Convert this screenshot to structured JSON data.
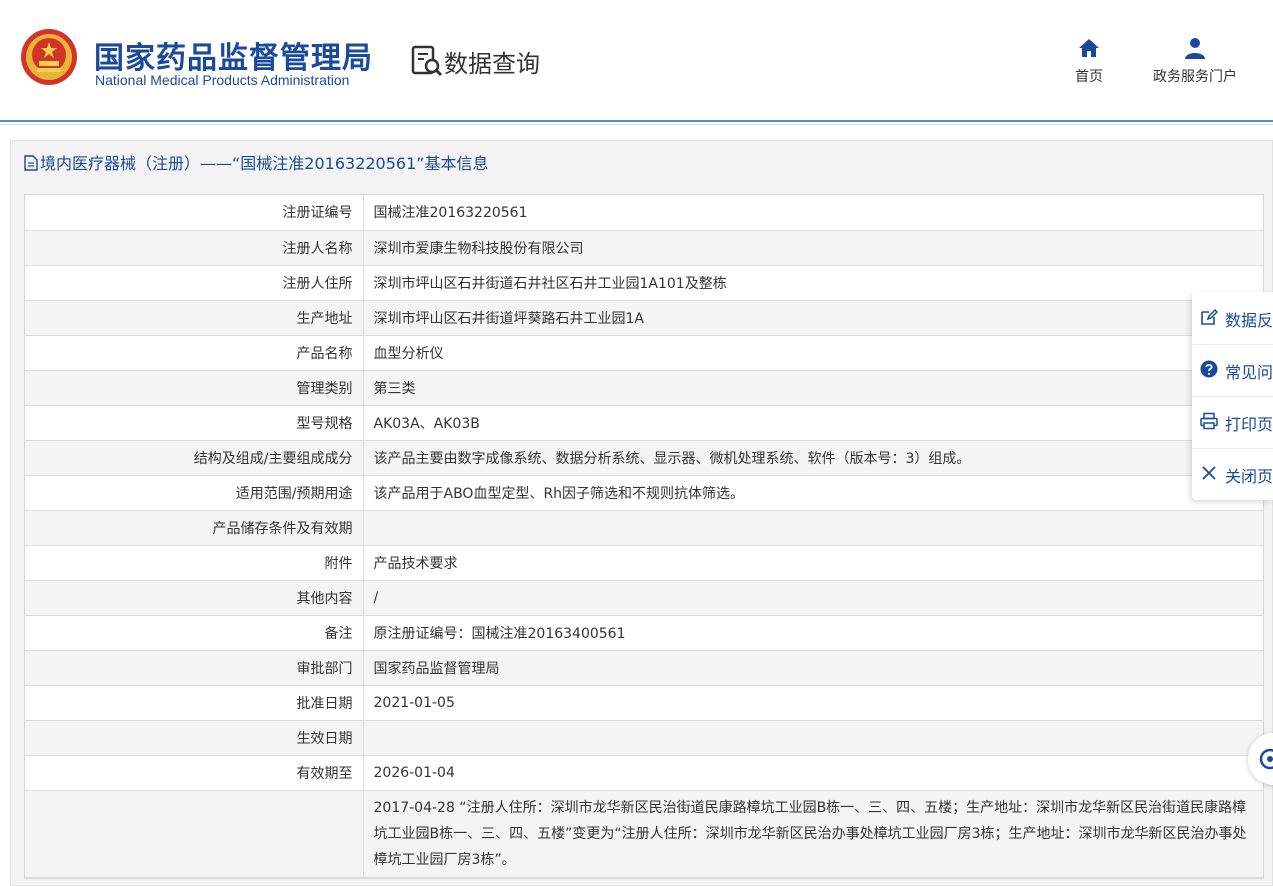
{
  "header": {
    "org_name_cn": "国家药品监督管理局",
    "org_name_en": "National Medical Products Administration",
    "section_title": "数据查询",
    "nav": [
      {
        "label": "首页",
        "icon": "home-icon"
      },
      {
        "label": "政务服务门户",
        "icon": "user-icon"
      }
    ]
  },
  "panel": {
    "title": "境内医疗器械（注册）——“国械注准20163220561”基本信息"
  },
  "details": [
    {
      "label": "注册证编号",
      "value": "国械注准20163220561"
    },
    {
      "label": "注册人名称",
      "value": "深圳市爱康生物科技股份有限公司"
    },
    {
      "label": "注册人住所",
      "value": "深圳市坪山区石井街道石井社区石井工业园1A101及整栋"
    },
    {
      "label": "生产地址",
      "value": "深圳市坪山区石井街道坪葵路石井工业园1A"
    },
    {
      "label": "产品名称",
      "value": "血型分析仪"
    },
    {
      "label": "管理类别",
      "value": "第三类"
    },
    {
      "label": "型号规格",
      "value": "AK03A、AK03B"
    },
    {
      "label": "结构及组成/主要组成成分",
      "value": "该产品主要由数字成像系统、数据分析系统、显示器、微机处理系统、软件（版本号：3）组成。"
    },
    {
      "label": "适用范围/预期用途",
      "value": "该产品用于ABO血型定型、Rh因子筛选和不规则抗体筛选。"
    },
    {
      "label": "产品储存条件及有效期",
      "value": ""
    },
    {
      "label": "附件",
      "value": "产品技术要求"
    },
    {
      "label": "其他内容",
      "value": "/"
    },
    {
      "label": "备注",
      "value": "原注册证编号：国械注准20163400561"
    },
    {
      "label": "审批部门",
      "value": "国家药品监督管理局"
    },
    {
      "label": "批准日期",
      "value": "2021-01-05"
    },
    {
      "label": "生效日期",
      "value": ""
    },
    {
      "label": "有效期至",
      "value": "2026-01-04"
    },
    {
      "label": "",
      "value": "2017-04-28 “注册人住所：深圳市龙华新区民治街道民康路樟坑工业园B栋一、三、四、五楼；生产地址：深圳市龙华新区民治街道民康路樟坑工业园B栋一、三、四、五楼”变更为“注册人住所：深圳市龙华新区民治办事处樟坑工业园厂房3栋；生产地址：深圳市龙华新区民治办事处樟坑工业园厂房3栋”。"
    }
  ],
  "float_bar": [
    {
      "label": "数据反",
      "icon": "edit-icon"
    },
    {
      "label": "常见问",
      "icon": "question-icon"
    },
    {
      "label": "打印页",
      "icon": "printer-icon"
    },
    {
      "label": "关闭页",
      "icon": "close-icon"
    }
  ],
  "colors": {
    "brand_blue": "#1a4a9c",
    "header_line": "#5a8fb8",
    "row_alt": "#f4f4f4"
  }
}
